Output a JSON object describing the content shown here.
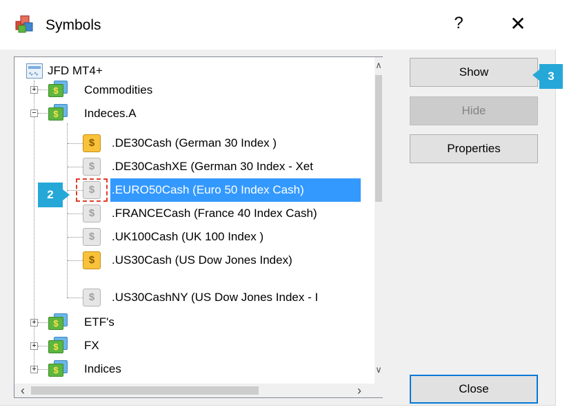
{
  "window": {
    "title": "Symbols",
    "help_label": "?",
    "close_label": "✕"
  },
  "tree": {
    "root": {
      "label": "JFD MT4+",
      "icon": "server-icon"
    },
    "groups": [
      {
        "label": "Commodities",
        "expanded": false,
        "expander": "+"
      },
      {
        "label": "Indeces.A",
        "expanded": true,
        "expander": "−"
      }
    ],
    "symbols": [
      {
        "label": ".DE30Cash  (German 30 Index )",
        "active": true,
        "selected": false
      },
      {
        "label": ".DE30CashXE  (German 30 Index  - Xet",
        "active": false,
        "selected": false
      },
      {
        "label": ".EURO50Cash  (Euro 50 Index Cash)",
        "active": false,
        "selected": true
      },
      {
        "label": ".FRANCECash  (France 40 Index Cash)",
        "active": false,
        "selected": false
      },
      {
        "label": ".UK100Cash  (UK 100 Index  )",
        "active": false,
        "selected": false
      },
      {
        "label": ".US30Cash  (US Dow Jones Index)",
        "active": true,
        "selected": false
      },
      {
        "label": ".US30CashNY  (US Dow Jones Index - I",
        "active": false,
        "selected": false
      }
    ],
    "groups_after": [
      {
        "label": "ETF's",
        "expander": "+"
      },
      {
        "label": "FX",
        "expander": "+"
      },
      {
        "label": "Indices",
        "expander": "+"
      }
    ],
    "coin_glyph": "$",
    "folder_glyph": "$"
  },
  "buttons": {
    "show": "Show",
    "hide": "Hide",
    "properties": "Properties",
    "close": "Close"
  },
  "callouts": {
    "selected_symbol": "2",
    "show_button": "3"
  },
  "colors": {
    "selection": "#3399ff",
    "callout": "#25a8d8",
    "default_button_border": "#0078d7",
    "highlight_dashed": "#e03c2c"
  }
}
